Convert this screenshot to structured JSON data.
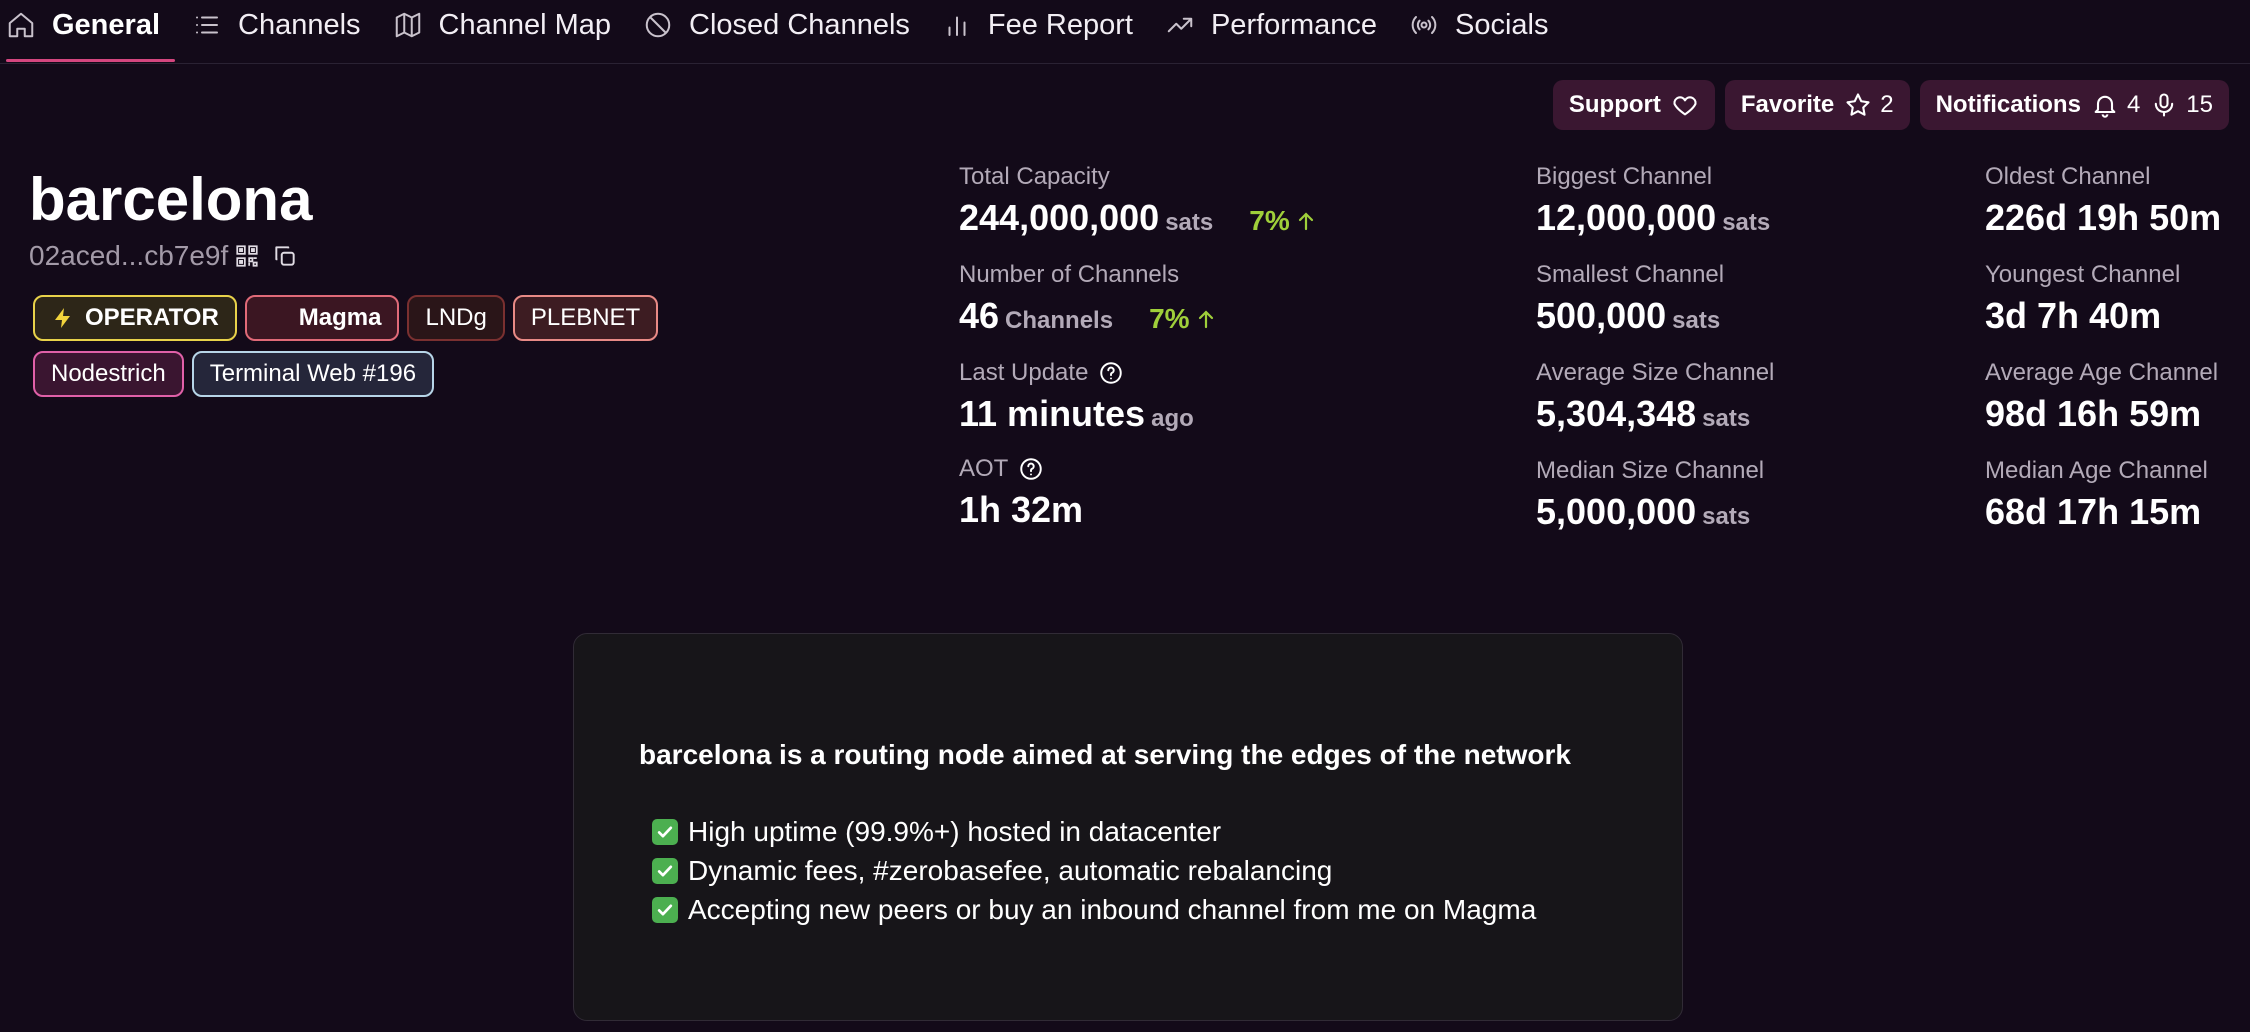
{
  "tabs": [
    {
      "label": "General",
      "icon": "home-icon",
      "active": true
    },
    {
      "label": "Channels",
      "icon": "list-icon"
    },
    {
      "label": "Channel Map",
      "icon": "map-icon"
    },
    {
      "label": "Closed Channels",
      "icon": "ban-icon"
    },
    {
      "label": "Fee Report",
      "icon": "bar-chart-icon"
    },
    {
      "label": "Performance",
      "icon": "trending-up-icon"
    },
    {
      "label": "Socials",
      "icon": "broadcast-icon"
    }
  ],
  "actions": {
    "support_label": "Support",
    "favorite_label": "Favorite",
    "favorite_count": "2",
    "notifications_label": "Notifications",
    "bell_count": "4",
    "mic_count": "15"
  },
  "node": {
    "alias": "barcelona",
    "pubkey_short": "02aced...cb7e9f"
  },
  "badges": [
    {
      "label": "OPERATOR",
      "icon": "lightning-icon"
    },
    {
      "label": "Magma"
    },
    {
      "label": "LNDg"
    },
    {
      "label": "PLEBNET"
    },
    {
      "label": "Nodestrich"
    },
    {
      "label": "Terminal Web #196"
    }
  ],
  "stats": {
    "total_capacity": {
      "label": "Total Capacity",
      "value": "244,000,000",
      "unit": "sats",
      "change": "7%"
    },
    "num_channels": {
      "label": "Number of Channels",
      "value": "46",
      "unit": "Channels",
      "change": "7%"
    },
    "last_update": {
      "label": "Last Update",
      "value": "11 minutes",
      "unit": "ago"
    },
    "aot": {
      "label": "AOT",
      "value": "1h 32m"
    },
    "biggest": {
      "label": "Biggest Channel",
      "value": "12,000,000",
      "unit": "sats"
    },
    "smallest": {
      "label": "Smallest Channel",
      "value": "500,000",
      "unit": "sats"
    },
    "average_size": {
      "label": "Average Size Channel",
      "value": "5,304,348",
      "unit": "sats"
    },
    "median_size": {
      "label": "Median Size Channel",
      "value": "5,000,000",
      "unit": "sats"
    },
    "oldest": {
      "label": "Oldest Channel",
      "value": "226d 19h 50m"
    },
    "youngest": {
      "label": "Youngest Channel",
      "value": "3d 7h 40m"
    },
    "average_age": {
      "label": "Average Age Channel",
      "value": "98d 16h 59m"
    },
    "median_age": {
      "label": "Median Age Channel",
      "value": "68d 17h 15m"
    }
  },
  "description": {
    "headline": "barcelona is a routing node aimed at serving the edges of the network",
    "items": [
      "High uptime (99.9%+) hosted in datacenter",
      "Dynamic fees, #zerobasefee, automatic rebalancing",
      "Accepting new peers or buy an inbound channel from me on Magma"
    ]
  },
  "colors": {
    "background": "#130a19",
    "accent": "#d4467f",
    "positive": "#9fcf3a",
    "button_bg": "#3a1731",
    "card_bg": "#171519"
  }
}
